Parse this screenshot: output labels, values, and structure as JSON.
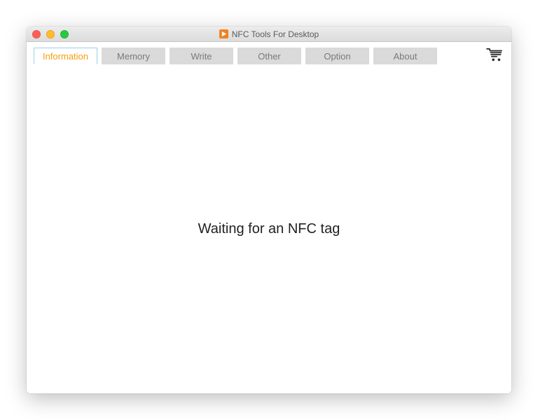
{
  "window": {
    "title": "NFC Tools For Desktop"
  },
  "tabs": [
    {
      "label": "Information",
      "active": true
    },
    {
      "label": "Memory",
      "active": false
    },
    {
      "label": "Write",
      "active": false
    },
    {
      "label": "Other",
      "active": false
    },
    {
      "label": "Option",
      "active": false
    },
    {
      "label": "About",
      "active": false
    }
  ],
  "main": {
    "message": "Waiting for an NFC tag"
  },
  "icons": {
    "cart": "cart-icon",
    "app": "app-icon"
  }
}
